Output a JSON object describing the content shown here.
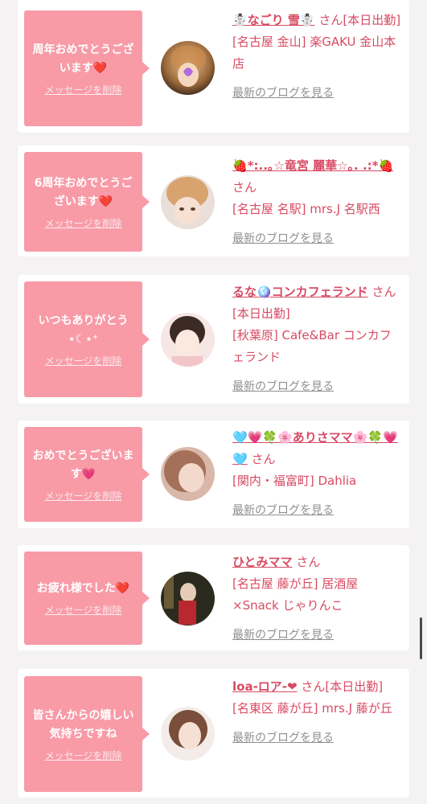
{
  "delete_label": "メッセージを削除",
  "blog_label": "最新のブログを見る",
  "san_label": "さん",
  "cards": [
    {
      "message": "周年おめでとうございます",
      "message_emoji": "❤️",
      "name": "☃️なごり 雪☃️",
      "status": "[本日出勤]",
      "location": "[名古屋 金山] 楽GAKU 金山本店"
    },
    {
      "message": "6周年おめでとうございます",
      "message_emoji": "❤️",
      "name": "🍓*:..｡☆竜宮 麗華☆｡. .:*🍓",
      "status": "",
      "location": "[名古屋 名駅] mrs.J 名駅西"
    },
    {
      "message": "いつもありがとう",
      "message_emoji": "⋆☾⋆⁺",
      "name": "るな🪩コンカフェランド",
      "status": "[本日出勤]",
      "location": "[秋葉原] Cafe&Bar コンカフェランド"
    },
    {
      "message": "おめでとうございます",
      "message_emoji": "💗",
      "name": "🩵💗🍀🌸ありさママ🌸🍀💗🩵",
      "status": "",
      "location": "[関内・福富町] Dahlia"
    },
    {
      "message": "お疲れ様でした",
      "message_emoji": "❤️",
      "name": "ひとみママ",
      "status": "",
      "location": "[名古屋 藤が丘] 居酒屋×Snack じゃりんこ"
    },
    {
      "message": "皆さんからの嬉しい気持ちですね",
      "message_emoji": "",
      "name": "loa-ロア-❤",
      "status": "[本日出勤]",
      "location": "[名東区 藤が丘] mrs.J 藤が丘"
    }
  ],
  "colors": {
    "bubble": "#f89ba7",
    "accent": "#d84a62",
    "link_gray": "#8f8f8f",
    "background": "#f4f2f2"
  }
}
